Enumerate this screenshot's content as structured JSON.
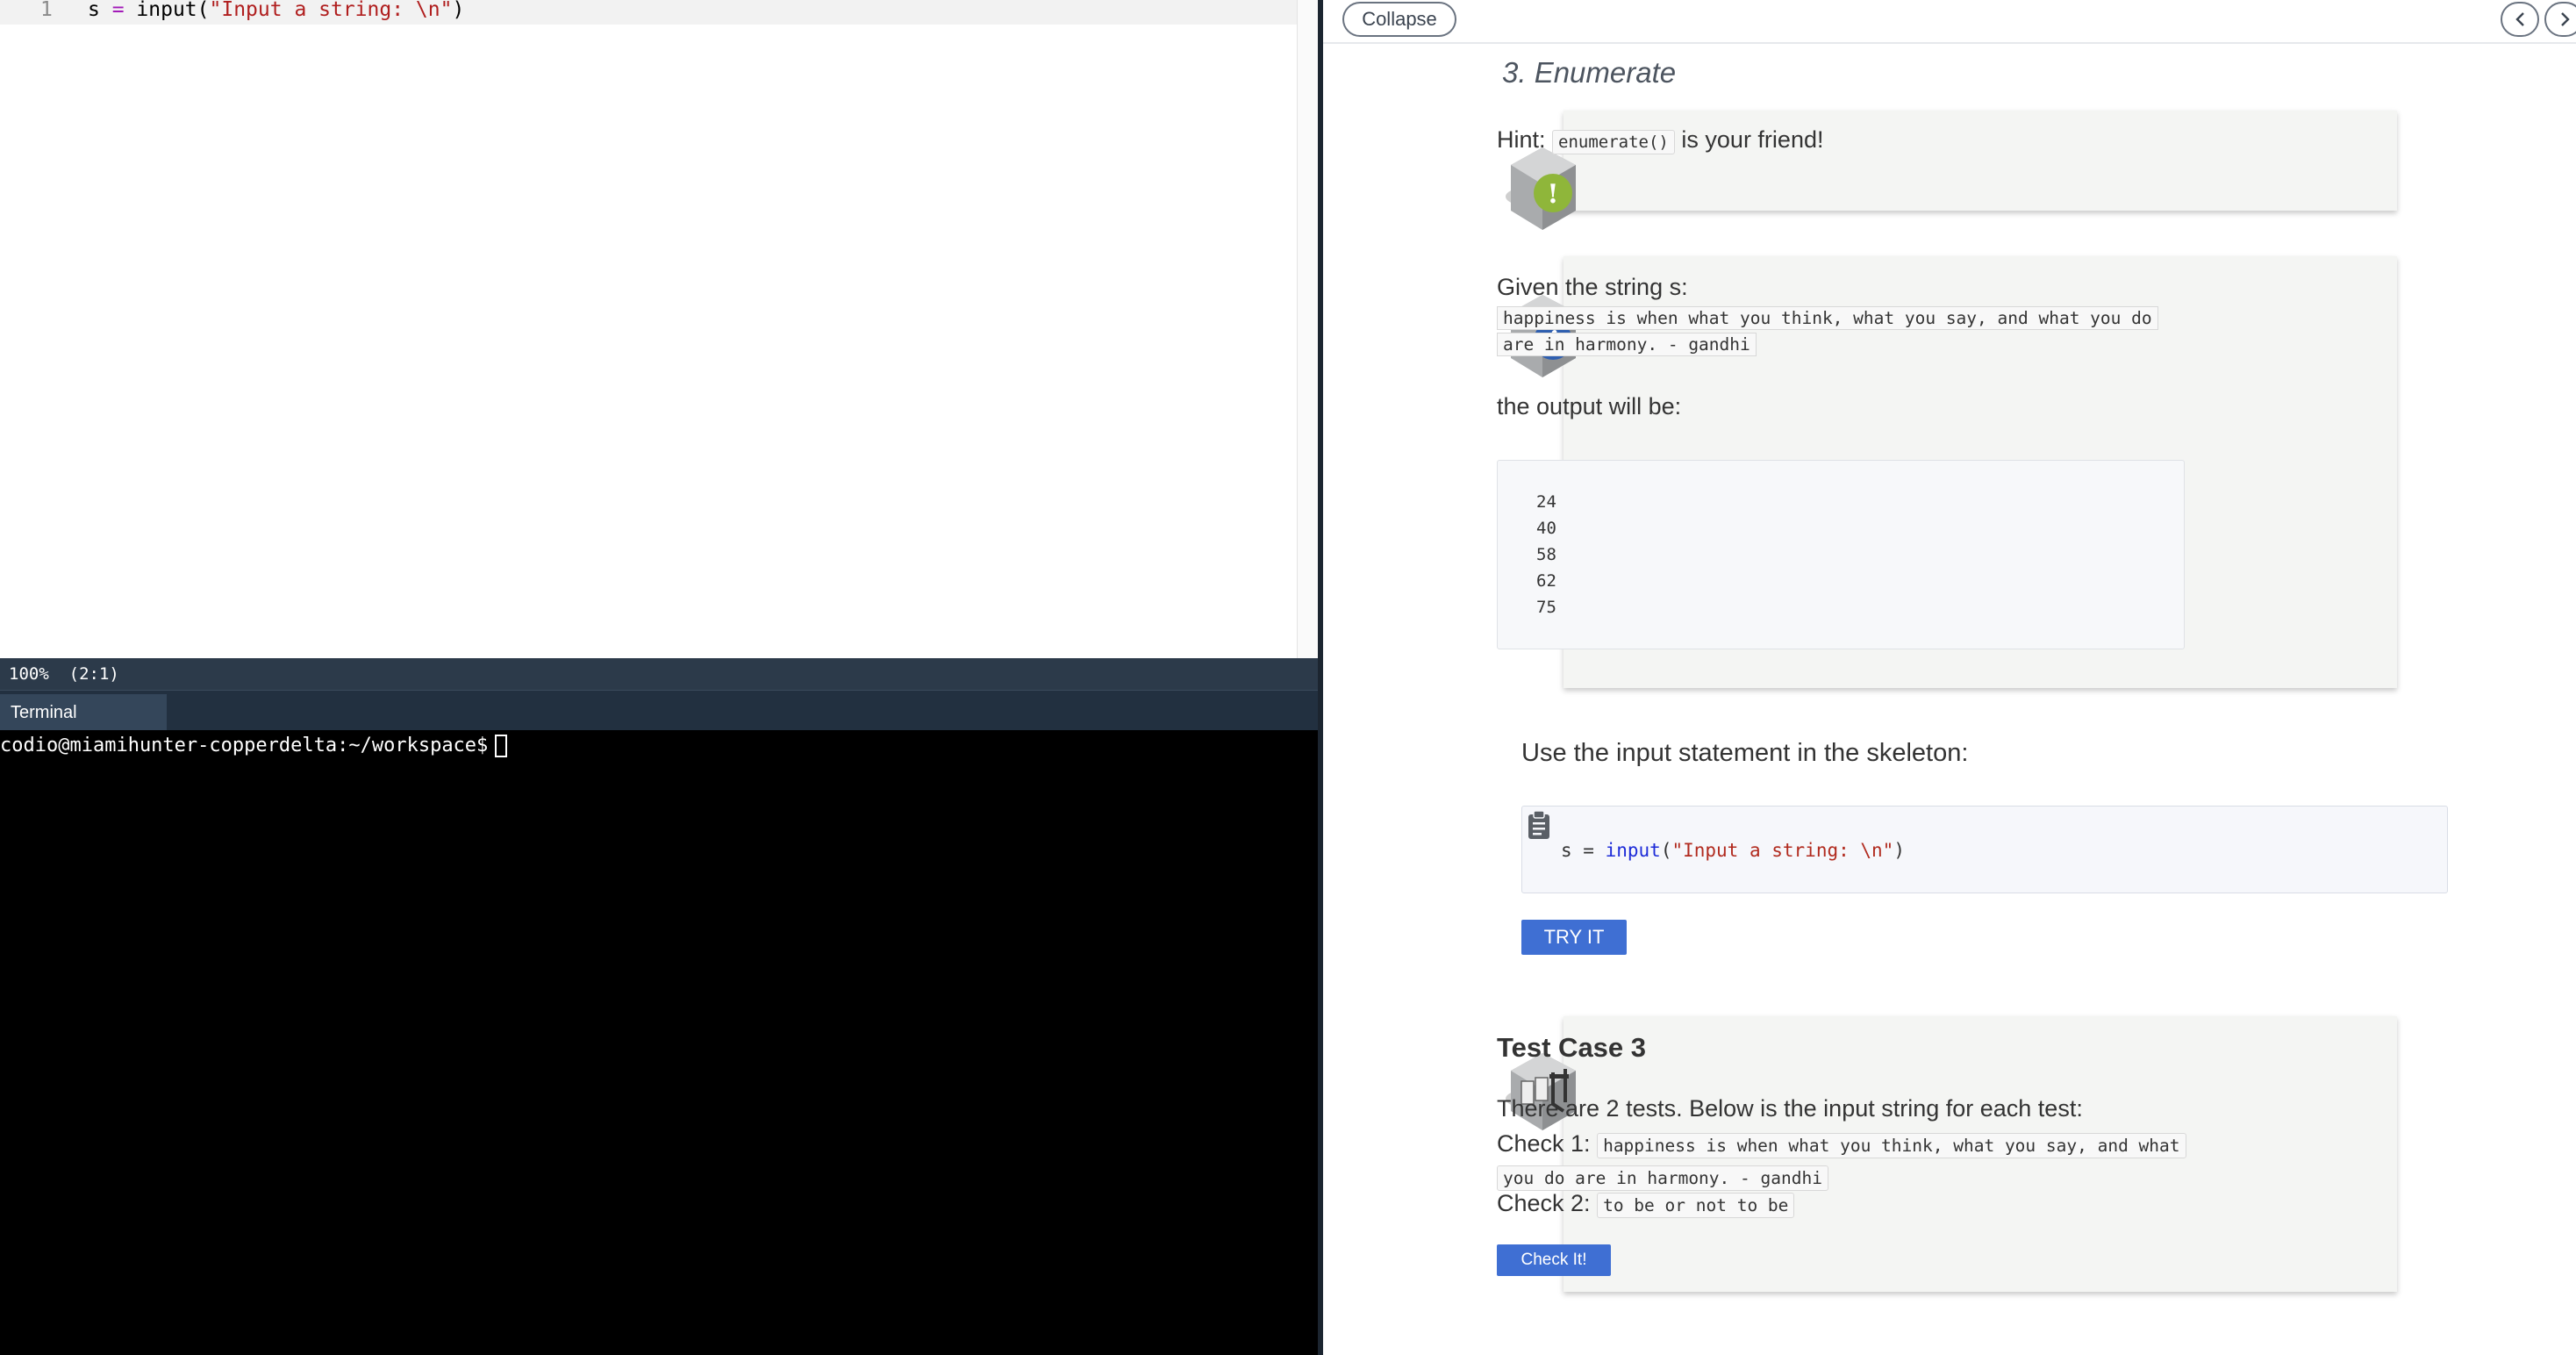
{
  "editor": {
    "line_number": "1",
    "code": {
      "var": "s",
      "op": " = ",
      "fn": "input",
      "open": "(",
      "str": "\"Input a string: \\n\"",
      "close": ")"
    }
  },
  "status_bar": {
    "text": "100%  (2:1)"
  },
  "terminal": {
    "tab_label": "Terminal",
    "prompt": "codio@miamihunter-copperdelta:~/workspace$"
  },
  "guide": {
    "collapse_label": "Collapse",
    "section_title": "3. Enumerate",
    "hint": {
      "prefix": "Hint:",
      "code": "enumerate()",
      "suffix": "is your friend!"
    },
    "given": {
      "label": "Given the string s:",
      "code": "happiness is when what you think, what you say, and what you do are in harmony. - gandhi",
      "output_label": "the output will be:",
      "output_values": [
        "24",
        "40",
        "58",
        "62",
        "75"
      ]
    },
    "instruction": "Use the input statement in the skeleton:",
    "skeleton": {
      "var": "s",
      "op": " = ",
      "fn": "input",
      "open": "(",
      "str": "\"Input a string: \\n\"",
      "close": ")"
    },
    "try_label": "TRY IT",
    "test_case": {
      "title": "Test Case 3",
      "description": "There are 2 tests. Below is the input string for each test:",
      "check1_label": "Check 1:",
      "check1_code": "happiness is when what you think, what you say, and what you do are in harmony. - gandhi",
      "check2_label": "Check 2:",
      "check2_code": "to be or not to be",
      "button_label": "Check It!"
    }
  },
  "colors": {
    "accent_button": "#3f6fd3",
    "status_bar": "#2c3a4a",
    "string_token": "#b01e1e",
    "keyword_token": "#1d2bd8"
  },
  "icons": [
    "warning-hex-icon",
    "info-hex-icon",
    "test-case-hex-icon",
    "clipboard-icon",
    "chevron-left-icon",
    "chevron-right-icon"
  ]
}
